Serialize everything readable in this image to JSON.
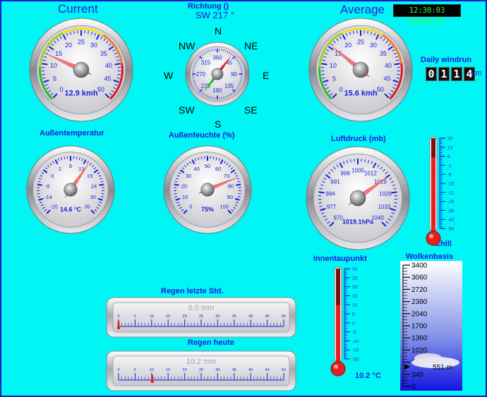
{
  "header": {
    "current_label": "Current",
    "average_label": "Average",
    "direction_title": "Richtung ()",
    "direction_value": "SW  217 °",
    "datetime": "12:30:03 09/06/25"
  },
  "compass": {
    "n": "N",
    "ne": "NE",
    "e": "E",
    "se": "SE",
    "s": "S",
    "sw": "SW",
    "w": "W",
    "nw": "NW"
  },
  "wind_current": {
    "value_text": "12.9 kmh",
    "ticks": [
      "0",
      "5",
      "10",
      "15",
      "20",
      "25",
      "30",
      "35",
      "40",
      "45",
      "50"
    ],
    "value": 12.9,
    "max": 50
  },
  "wind_average": {
    "value_text": "15.6 kmh",
    "ticks": [
      "0",
      "5",
      "10",
      "15",
      "20",
      "25",
      "30",
      "35",
      "40",
      "45",
      "50"
    ],
    "value": 15.6,
    "max": 50
  },
  "direction_dial": {
    "ticks": [
      "360",
      "45",
      "90",
      "135",
      "180",
      "225",
      "270",
      "315"
    ],
    "bearing": 217
  },
  "daily_windrun": {
    "label": "Daily windrun",
    "digits": [
      "0",
      "1",
      "1",
      "4"
    ],
    "unit": "km"
  },
  "outdoor_temp": {
    "label": "Außentemperatur",
    "value_text": "14.6 °C",
    "ticks": [
      "-20",
      "-14",
      "-9",
      "-3",
      "2",
      "8",
      "13",
      "19",
      "24",
      "30",
      "35"
    ],
    "value": 14.6,
    "min": -20,
    "max": 35
  },
  "outdoor_humidity": {
    "label": "Außenfeuchte (%)",
    "value_text": "75%",
    "ticks": [
      "0",
      "10",
      "20",
      "30",
      "40",
      "50",
      "60",
      "70",
      "80",
      "90",
      "100"
    ],
    "value": 75,
    "min": 0,
    "max": 100
  },
  "pressure": {
    "label": "Luftdruck (mb)",
    "value_text": "1019.1hPa",
    "ticks": [
      "970",
      "977",
      "984",
      "991",
      "998",
      "1005",
      "1012",
      "1019",
      "1026",
      "1033",
      "1040"
    ],
    "value": 1019.1,
    "min": 970,
    "max": 1040
  },
  "chill": {
    "label": "Chill",
    "ticks": [
      "20",
      "13",
      "6",
      "-1",
      "-8",
      "-15",
      "-22",
      "-29",
      "-36",
      "-43",
      "-50"
    ],
    "level_fraction": 0.78
  },
  "dewpoint": {
    "label": "Innentaupunkt",
    "value_text": "10.2 °C",
    "ticks": [
      "30",
      "25",
      "20",
      "15",
      "10",
      "5",
      "0",
      "-5",
      "-10",
      "-15",
      "-20"
    ],
    "level_fraction": 0.6
  },
  "cloud_base": {
    "label": "Wolkenbasis",
    "ticks": [
      "3400",
      "3060",
      "2720",
      "2380",
      "2040",
      "1700",
      "1360",
      "1020",
      "680",
      "340",
      "0"
    ],
    "value_text": "551 m",
    "value": 551
  },
  "rain_hour": {
    "label": "Regen letzte Std.",
    "value_text": "0.0 mm",
    "ticks": [
      "0",
      "5",
      "10",
      "15",
      "20",
      "25",
      "30",
      "35",
      "40",
      "45",
      "50"
    ],
    "value": 0,
    "max": 50
  },
  "rain_today": {
    "label": "Regen heute",
    "value_text": "10.2 mm",
    "ticks": [
      "0",
      "5",
      "10",
      "15",
      "20",
      "25",
      "30",
      "35",
      "40",
      "45",
      "50"
    ],
    "value": 10.2,
    "max": 50
  }
}
